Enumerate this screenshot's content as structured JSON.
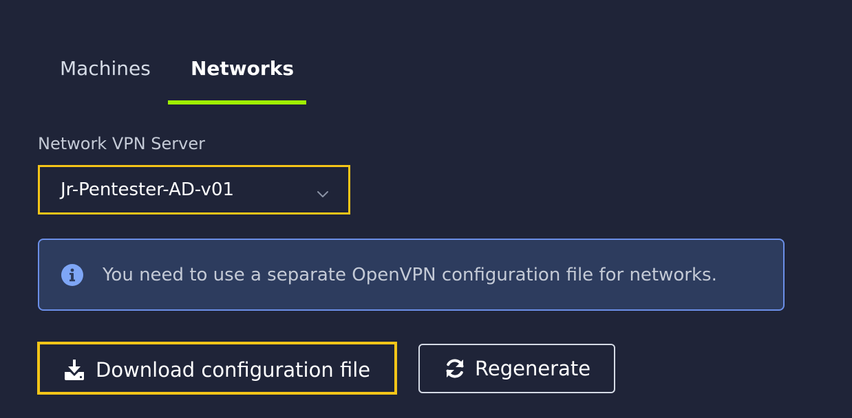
{
  "tabs": {
    "machines": "Machines",
    "networks": "Networks",
    "active": "networks",
    "accent_color": "#9fef00"
  },
  "network_vpn": {
    "label": "Network VPN Server",
    "selected": "Jr-Pentester-AD-v01"
  },
  "info": {
    "message": "You need to use a separate OpenVPN configuration file for networks.",
    "icon": "info-icon"
  },
  "buttons": {
    "download_label": "Download configuration file",
    "download_icon": "download-icon",
    "regenerate_label": "Regenerate",
    "regenerate_icon": "refresh-icon"
  },
  "colors": {
    "background": "#1f2438",
    "highlight_border": "#f5c518",
    "info_background": "#2d3c5e",
    "info_border": "#6b8fe8"
  }
}
